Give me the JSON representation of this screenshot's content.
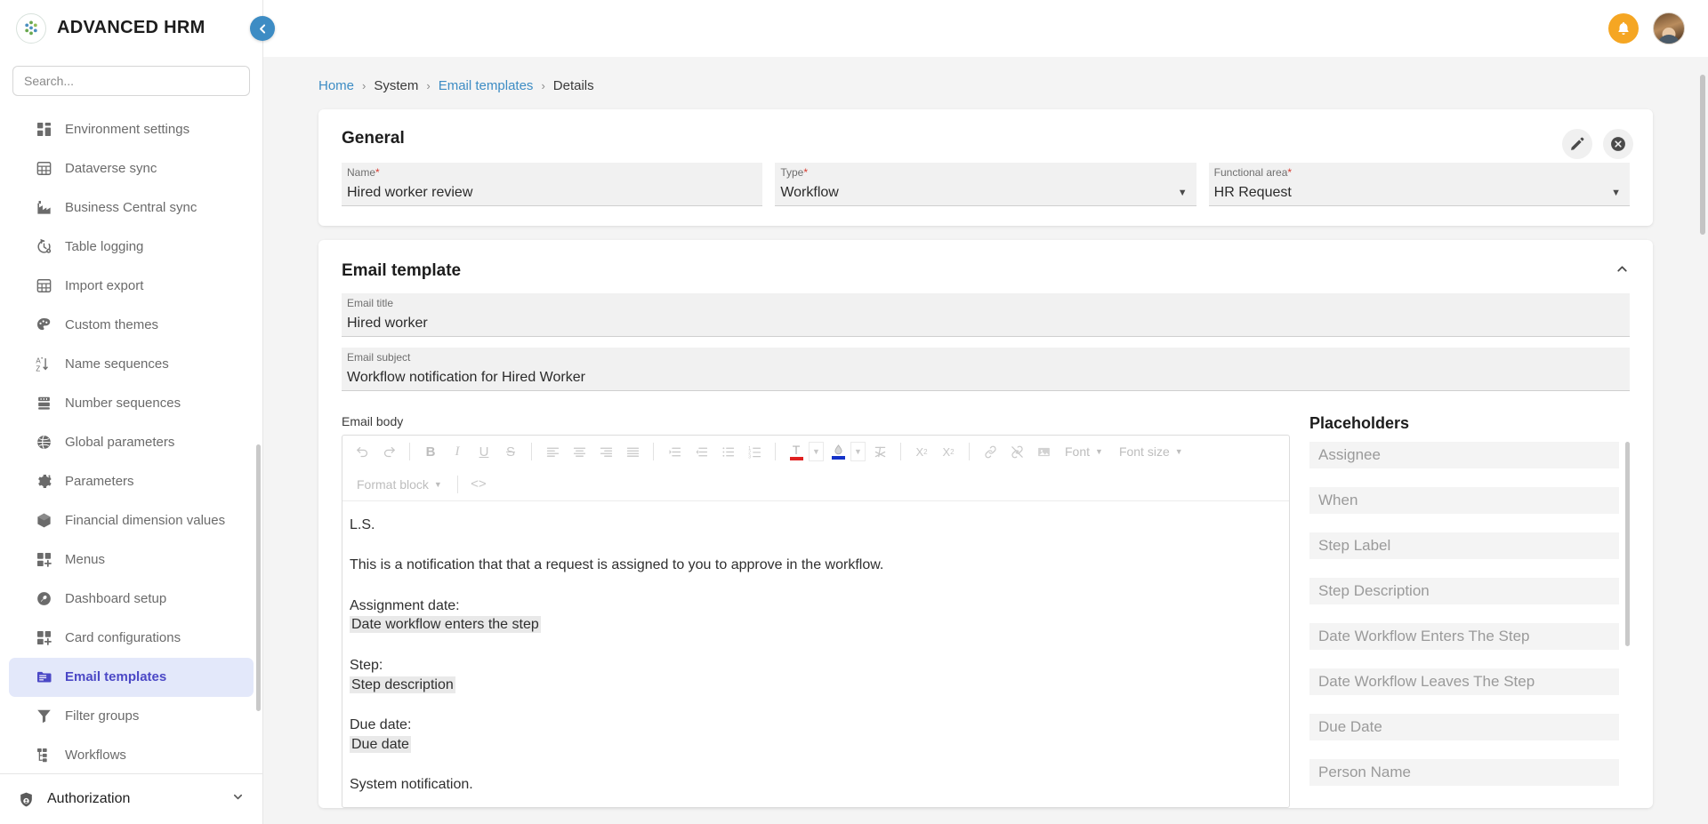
{
  "brand": {
    "name": "ADVANCED HRM",
    "logo_icon": "dotted-circle-logo"
  },
  "search": {
    "placeholder": "Search...",
    "value": ""
  },
  "sidebar": {
    "collapse_icon": "chevron-left-icon",
    "items": [
      {
        "label": "Environment settings",
        "icon": "dashboard-grid-icon"
      },
      {
        "label": "Dataverse sync",
        "icon": "table-sync-icon"
      },
      {
        "label": "Business Central sync",
        "icon": "factory-icon"
      },
      {
        "label": "Table logging",
        "icon": "history-gear-icon"
      },
      {
        "label": "Import export",
        "icon": "table-transfer-icon"
      },
      {
        "label": "Custom themes",
        "icon": "palette-icon"
      },
      {
        "label": "Name sequences",
        "icon": "sort-az-icon"
      },
      {
        "label": "Number sequences",
        "icon": "number-stack-icon"
      },
      {
        "label": "Global parameters",
        "icon": "globe-icon"
      },
      {
        "label": "Parameters",
        "icon": "gear-icon"
      },
      {
        "label": "Financial dimension values",
        "icon": "cube-icon"
      },
      {
        "label": "Menus",
        "icon": "grid-plus-icon"
      },
      {
        "label": "Dashboard setup",
        "icon": "wrench-icon"
      },
      {
        "label": "Card configurations",
        "icon": "grid-plus-icon"
      },
      {
        "label": "Email templates",
        "icon": "mail-folder-icon",
        "active": true
      },
      {
        "label": "Filter groups",
        "icon": "funnel-icon"
      },
      {
        "label": "Workflows",
        "icon": "sitemap-icon"
      }
    ],
    "footer": {
      "label": "Authorization",
      "icon": "shield-user-icon",
      "chevron": "chevron-down-icon"
    }
  },
  "topbar": {
    "notification_icon": "bell-icon",
    "notification_color": "#f5a623",
    "avatar_icon": "user-avatar"
  },
  "breadcrumb": [
    {
      "label": "Home",
      "link": true
    },
    {
      "label": "System",
      "link": false
    },
    {
      "label": "Email templates",
      "link": true
    },
    {
      "label": "Details",
      "link": false
    }
  ],
  "general": {
    "title": "General",
    "edit_icon": "pencil-icon",
    "close_icon": "close-circle-icon",
    "fields": [
      {
        "label": "Name",
        "required": true,
        "value": "Hired worker review",
        "type": "text"
      },
      {
        "label": "Type",
        "required": true,
        "value": "Workflow",
        "type": "select"
      },
      {
        "label": "Functional area",
        "required": true,
        "value": "HR Request",
        "type": "select"
      }
    ]
  },
  "email_template": {
    "title": "Email template",
    "collapse_icon": "chevron-up-icon",
    "email_title": {
      "label": "Email title",
      "value": "Hired worker"
    },
    "email_subject": {
      "label": "Email subject",
      "value": "Workflow notification for Hired Worker"
    },
    "email_body_label": "Email body",
    "toolbar_row1": [
      {
        "name": "undo-icon",
        "glyph": "undo"
      },
      {
        "name": "redo-icon",
        "glyph": "redo"
      },
      {
        "sep": true
      },
      {
        "name": "bold-icon",
        "glyph": "B"
      },
      {
        "name": "italic-icon",
        "glyph": "I"
      },
      {
        "name": "underline-icon",
        "glyph": "U"
      },
      {
        "name": "strikethrough-icon",
        "glyph": "S"
      },
      {
        "sep": true
      },
      {
        "name": "align-left-icon",
        "glyph": "align-left"
      },
      {
        "name": "align-center-icon",
        "glyph": "align-center"
      },
      {
        "name": "align-right-icon",
        "glyph": "align-right"
      },
      {
        "name": "align-justify-icon",
        "glyph": "align-justify"
      },
      {
        "sep": true
      },
      {
        "name": "indent-icon",
        "glyph": "indent"
      },
      {
        "name": "outdent-icon",
        "glyph": "outdent"
      },
      {
        "name": "bullet-list-icon",
        "glyph": "bullets"
      },
      {
        "name": "numbered-list-icon",
        "glyph": "numbers"
      },
      {
        "sep": true
      },
      {
        "name": "text-color-icon",
        "glyph": "T",
        "color": "#e02020"
      },
      {
        "name": "highlight-color-icon",
        "glyph": "drop",
        "color": "#1432c8"
      },
      {
        "name": "clear-format-icon",
        "glyph": "clear"
      },
      {
        "sep": true
      },
      {
        "name": "subscript-icon",
        "glyph": "X2sub"
      },
      {
        "name": "superscript-icon",
        "glyph": "X2sup"
      },
      {
        "sep": true
      },
      {
        "name": "link-icon",
        "glyph": "link"
      },
      {
        "name": "unlink-icon",
        "glyph": "unlink"
      },
      {
        "name": "image-icon",
        "glyph": "image"
      }
    ],
    "font_dropdown": "Font",
    "font_size_dropdown": "Font size",
    "format_block_dropdown": "Format block",
    "source_code_label": "<>",
    "body_blocks": [
      {
        "text": "L.S."
      },
      {
        "text": "This is a notification that that a request is assigned to you to approve in the workflow."
      },
      {
        "text": "Assignment date:",
        "token": "Date workflow enters the step"
      },
      {
        "text": "Step:",
        "token": "Step description"
      },
      {
        "text": "Due date:",
        "token": "Due date"
      },
      {
        "text": "System notification."
      }
    ]
  },
  "placeholders": {
    "title": "Placeholders",
    "items": [
      "Assignee",
      "When",
      "Step Label",
      "Step Description",
      "Date Workflow Enters The Step",
      "Date Workflow Leaves The Step",
      "Due Date",
      "Person Name"
    ]
  },
  "colors": {
    "accent_blue": "#3d8cc4",
    "active_nav_bg": "#e3e8fa",
    "active_nav_text": "#4b48c6",
    "notification_orange": "#f5a623"
  }
}
